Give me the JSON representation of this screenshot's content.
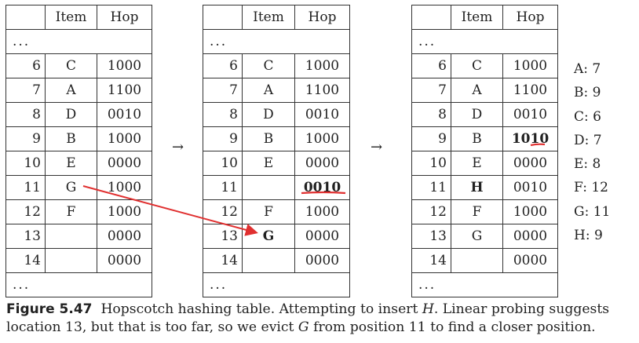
{
  "tables": [
    {
      "header": {
        "index": "",
        "item": "Item",
        "hop": "Hop"
      },
      "top_ellipsis": "...",
      "rows": [
        {
          "index": "6",
          "item": "C",
          "hop": "1000"
        },
        {
          "index": "7",
          "item": "A",
          "hop": "1100"
        },
        {
          "index": "8",
          "item": "D",
          "hop": "0010"
        },
        {
          "index": "9",
          "item": "B",
          "hop": "1000"
        },
        {
          "index": "10",
          "item": "E",
          "hop": "0000"
        },
        {
          "index": "11",
          "item": "G",
          "hop": "1000"
        },
        {
          "index": "12",
          "item": "F",
          "hop": "1000"
        },
        {
          "index": "13",
          "item": "",
          "hop": "0000"
        },
        {
          "index": "14",
          "item": "",
          "hop": "0000"
        }
      ],
      "bottom_ellipsis": "..."
    },
    {
      "header": {
        "index": "",
        "item": "Item",
        "hop": "Hop"
      },
      "top_ellipsis": "...",
      "rows": [
        {
          "index": "6",
          "item": "C",
          "hop": "1000"
        },
        {
          "index": "7",
          "item": "A",
          "hop": "1100"
        },
        {
          "index": "8",
          "item": "D",
          "hop": "0010"
        },
        {
          "index": "9",
          "item": "B",
          "hop": "1000"
        },
        {
          "index": "10",
          "item": "E",
          "hop": "0000"
        },
        {
          "index": "11",
          "item": "",
          "hop": "0010"
        },
        {
          "index": "12",
          "item": "F",
          "hop": "1000"
        },
        {
          "index": "13",
          "item": "G",
          "hop": "0000"
        },
        {
          "index": "14",
          "item": "",
          "hop": "0000"
        }
      ],
      "bottom_ellipsis": "..."
    },
    {
      "header": {
        "index": "",
        "item": "Item",
        "hop": "Hop"
      },
      "top_ellipsis": "...",
      "rows": [
        {
          "index": "6",
          "item": "C",
          "hop": "1000"
        },
        {
          "index": "7",
          "item": "A",
          "hop": "1100"
        },
        {
          "index": "8",
          "item": "D",
          "hop": "0010"
        },
        {
          "index": "9",
          "item": "B",
          "hop": "1010"
        },
        {
          "index": "10",
          "item": "E",
          "hop": "0000"
        },
        {
          "index": "11",
          "item": "H",
          "hop": "0010"
        },
        {
          "index": "12",
          "item": "F",
          "hop": "1000"
        },
        {
          "index": "13",
          "item": "G",
          "hop": "0000"
        },
        {
          "index": "14",
          "item": "",
          "hop": "0000"
        }
      ],
      "bottom_ellipsis": "..."
    }
  ],
  "arrows": [
    "→",
    "→"
  ],
  "legend": [
    "A: 7",
    "B: 9",
    "C: 6",
    "D: 7",
    "E: 8",
    "F: 12",
    "G: 11",
    "H: 9"
  ],
  "caption": {
    "label": "Figure 5.47",
    "text_1": "Hopscotch hashing table. Attempting to insert ",
    "italic_1": "H",
    "text_2": ". Linear probing suggests location 13, but that is too far, so we evict ",
    "italic_2": "G",
    "text_3": " from position 11 to find a closer position."
  },
  "colors": {
    "annotation": "#e03030",
    "text": "#222222"
  }
}
